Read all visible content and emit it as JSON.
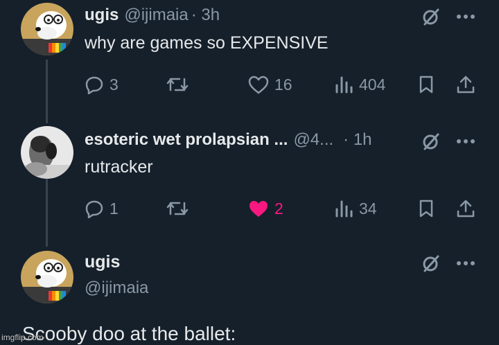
{
  "tweet1": {
    "name": "ugis",
    "handle": "@ijimaia",
    "time": "· 3h",
    "text": "why are games so EXPENSIVE",
    "stats": {
      "replies": "3",
      "likes": "16",
      "views": "404"
    }
  },
  "tweet2": {
    "name": "esoteric wet prolapsian ...",
    "handle": "@4...",
    "time": "· 1h",
    "text": "rutracker",
    "stats": {
      "replies": "1",
      "likes": "2",
      "views": "34"
    },
    "liked": true
  },
  "tweet3": {
    "name": "ugis",
    "handle": "@ijimaia",
    "text": "Scooby doo at the ballet:"
  },
  "watermark": "imgflip.com",
  "colors": {
    "background": "#15202b",
    "muted": "#8b98a5",
    "like": "#f91880",
    "text": "#e7e9ea"
  },
  "icons": [
    "grok-icon",
    "more-icon",
    "reply-icon",
    "retweet-icon",
    "like-icon",
    "views-icon",
    "bookmark-icon",
    "share-icon"
  ]
}
